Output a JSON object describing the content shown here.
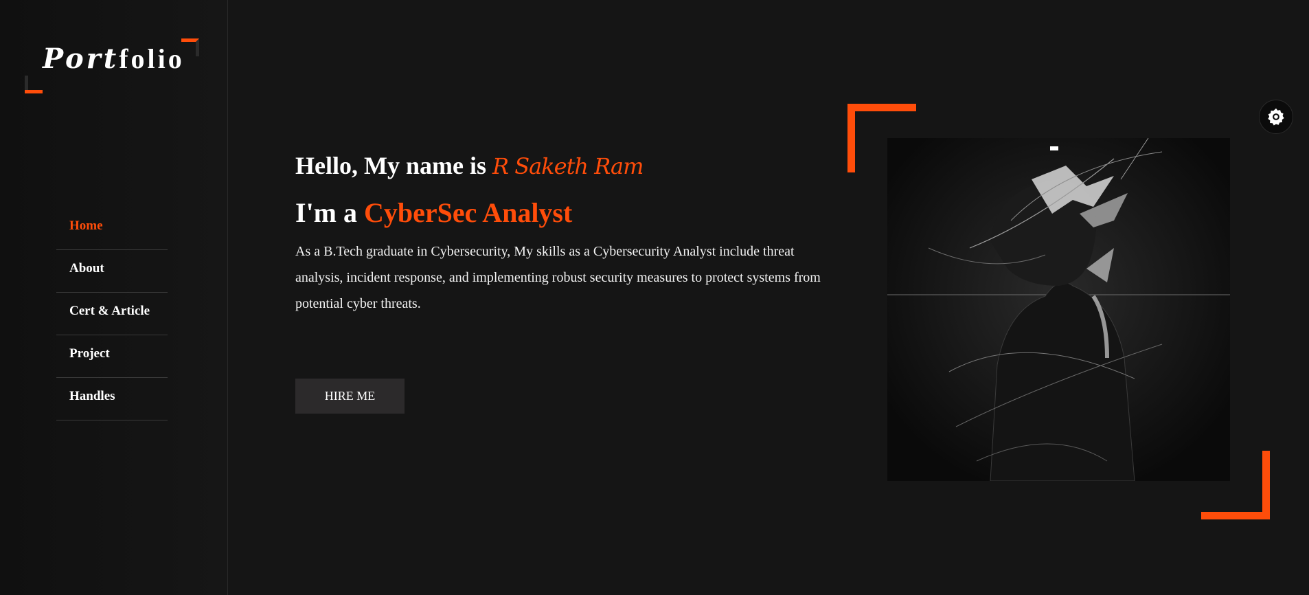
{
  "sidebar": {
    "logo": {
      "part1": "Port",
      "part2": "folio"
    },
    "nav": [
      {
        "label": "Home",
        "active": true
      },
      {
        "label": "About",
        "active": false
      },
      {
        "label": "Cert & Article",
        "active": false
      },
      {
        "label": "Project",
        "active": false
      },
      {
        "label": "Handles",
        "active": false
      }
    ]
  },
  "hero": {
    "greeting_prefix": "Hello, My name is",
    "name": "R Saketh Ram",
    "role_prefix": "I'm a",
    "role": "CyberSec Analyst",
    "description": "As a B.Tech graduate in Cybersecurity, My skills as a Cybersecurity Analyst include threat analysis, incident response, and implementing robust security measures to protect systems from potential cyber threats.",
    "hire_button": "HIRE ME"
  },
  "theme_toggle": {
    "icon": "gear-icon"
  },
  "colors": {
    "accent": "#ff4d0a",
    "background": "#151515",
    "sidebar": "#111111",
    "button": "#2c2a2b"
  }
}
